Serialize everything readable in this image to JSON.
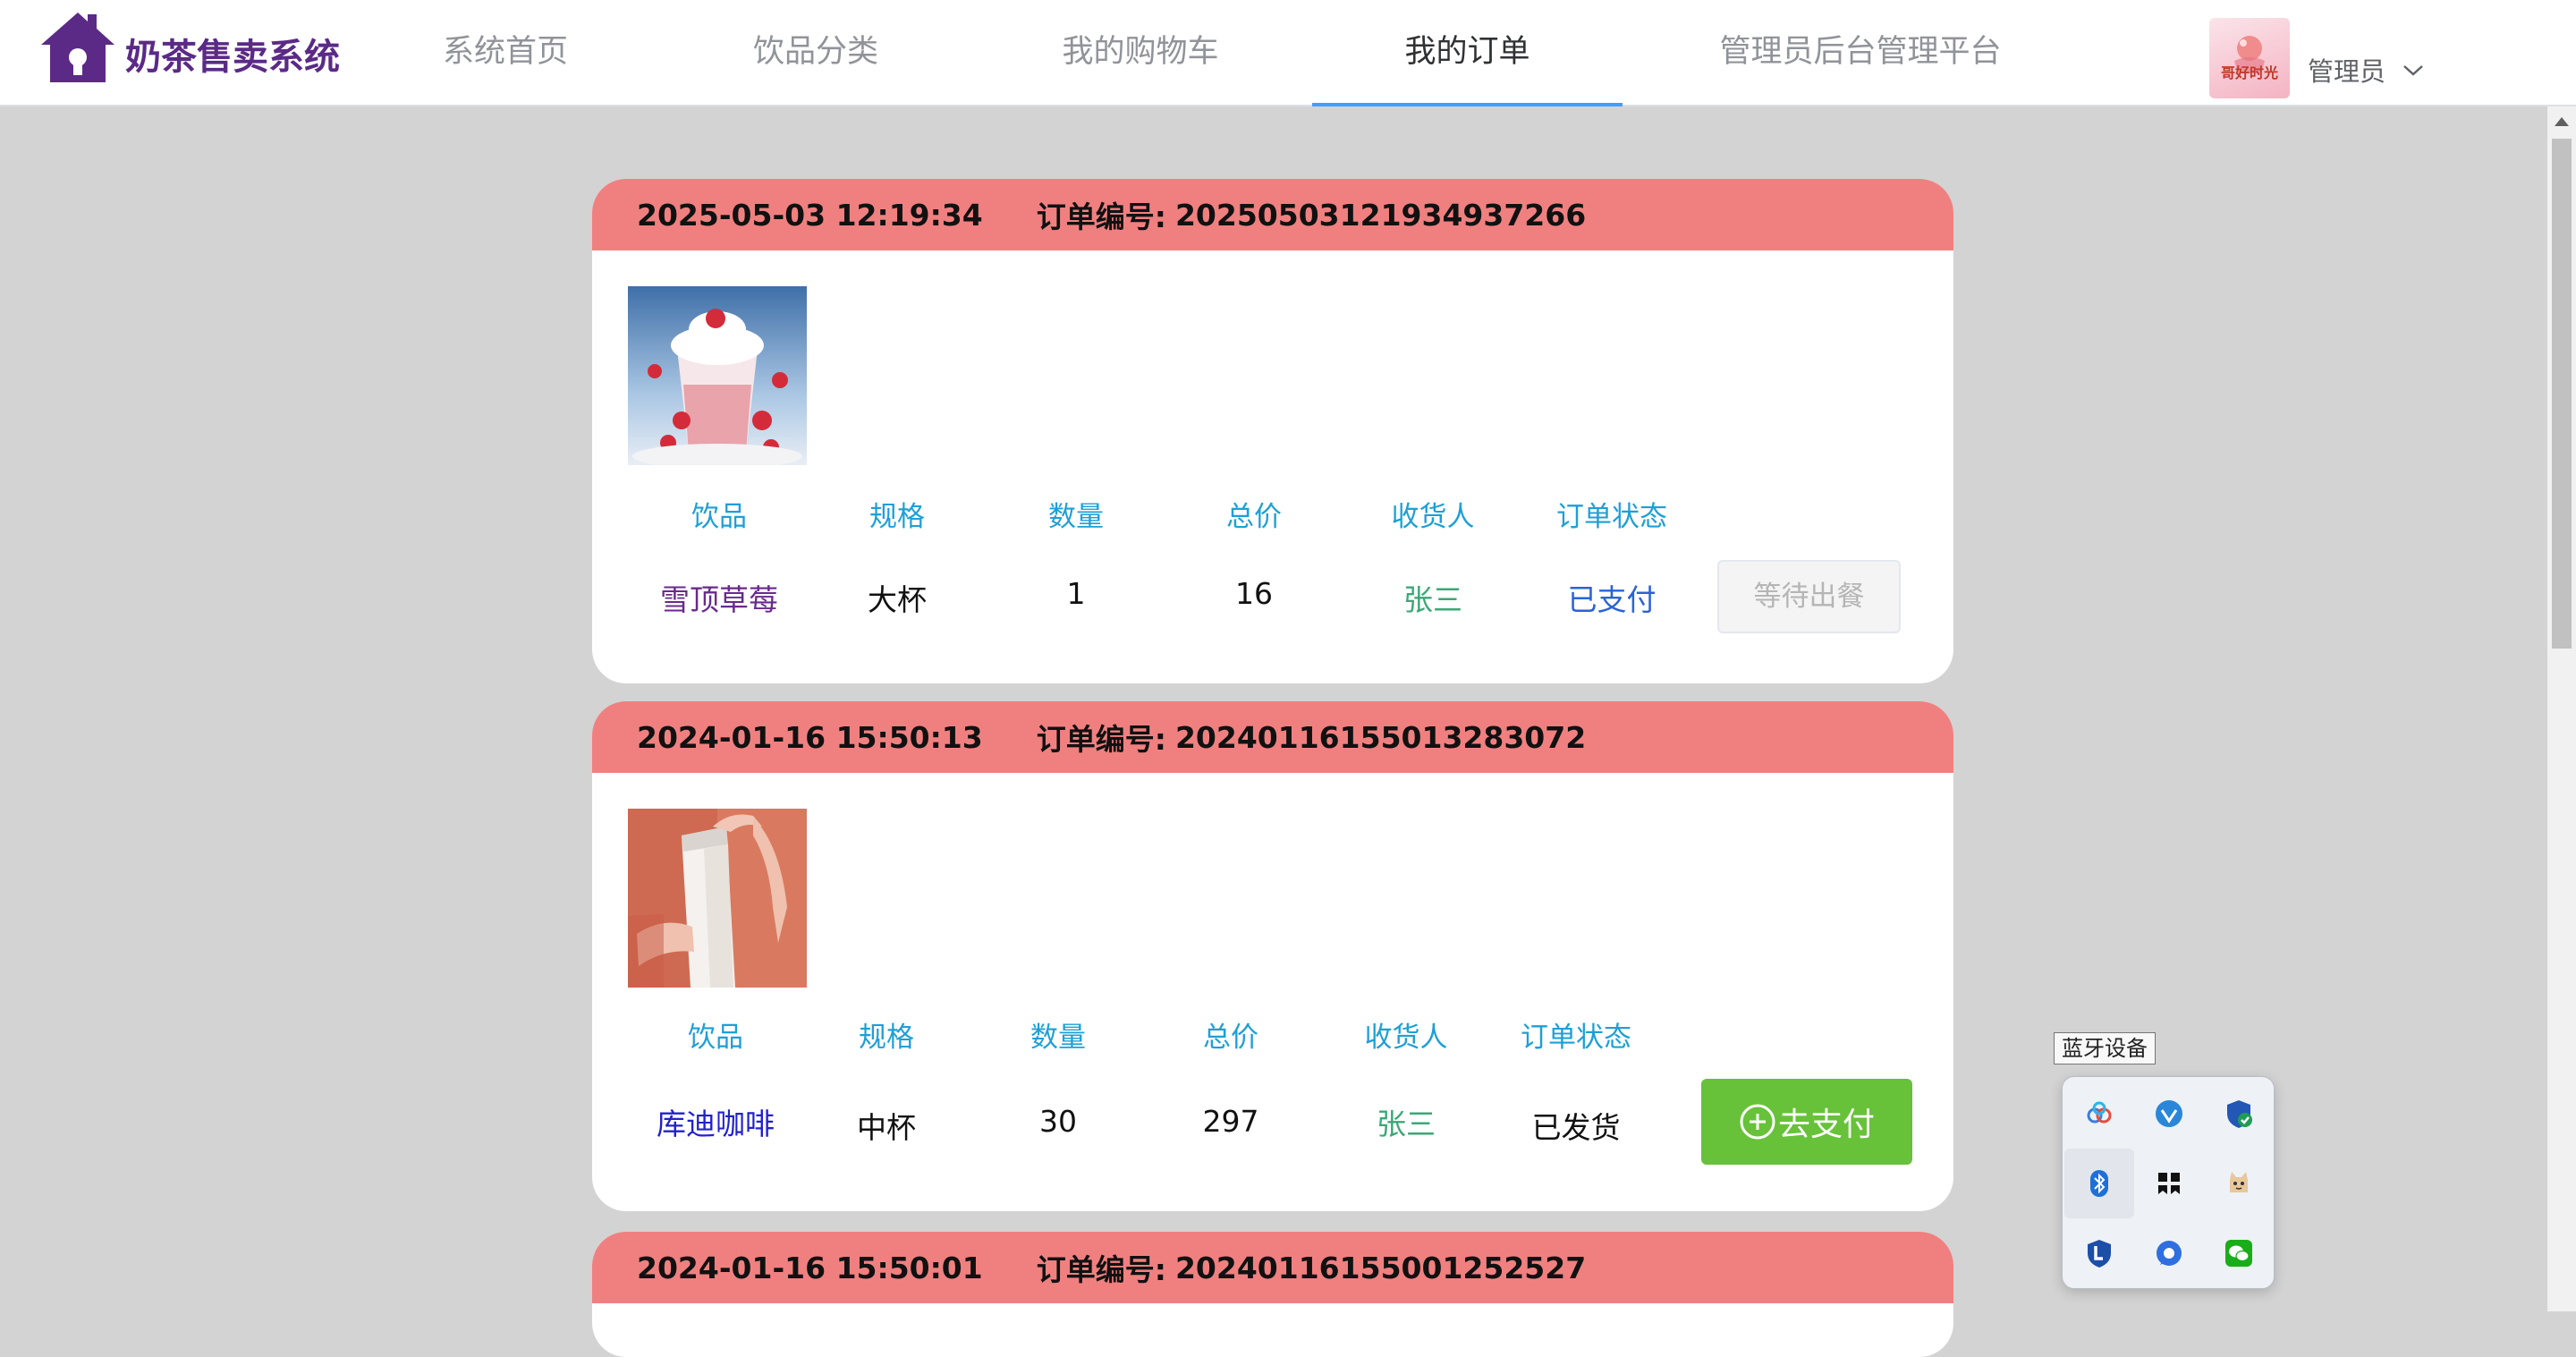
{
  "header": {
    "logo_text": "奶茶售卖系统",
    "nav": [
      {
        "label": "系统首页"
      },
      {
        "label": "饮品分类"
      },
      {
        "label": "我的购物车"
      },
      {
        "label": "我的订单",
        "active": true
      },
      {
        "label": "管理员后台管理平台"
      }
    ],
    "user": {
      "name": "管理员",
      "avatar_text": "哥好时光"
    }
  },
  "columns": {
    "drink": "饮品",
    "spec": "规格",
    "qty": "数量",
    "total": "总价",
    "receiver": "收货人",
    "status": "订单状态"
  },
  "orders": [
    {
      "time": "2025-05-03 12:19:34",
      "sn_label": "订单编号:",
      "sn": "20250503121934937266",
      "image": "strawberry-drink",
      "drink": "雪顶草莓",
      "spec": "大杯",
      "qty": "1",
      "total": "16",
      "receiver": "张三",
      "status": "已支付",
      "action": "等待出餐"
    },
    {
      "time": "2024-01-16 15:50:13",
      "sn_label": "订单编号:",
      "sn": "20240116155013283072",
      "image": "coffee-cup",
      "drink": "库迪咖啡",
      "spec": "中杯",
      "qty": "30",
      "total": "297",
      "receiver": "张三",
      "status": "已发货",
      "action": "去支付"
    },
    {
      "time": "2024-01-16 15:50:01",
      "sn_label": "订单编号:",
      "sn": "20240116155001252527"
    }
  ],
  "tray": {
    "tooltip": "蓝牙设备",
    "icons": [
      "baidu-netdisk-icon",
      "vpn-shield-icon",
      "security-shield-icon",
      "bluetooth-icon",
      "app-logo-icon",
      "cat-icon",
      "defender-icon",
      "bubble-icon",
      "wechat-icon"
    ]
  },
  "colors": {
    "order_header": "#f08080",
    "column_header": "#1e9fd6",
    "pay_button": "#67c23a",
    "logo": "#5b2a86",
    "active_nav_underline": "#409eff"
  }
}
